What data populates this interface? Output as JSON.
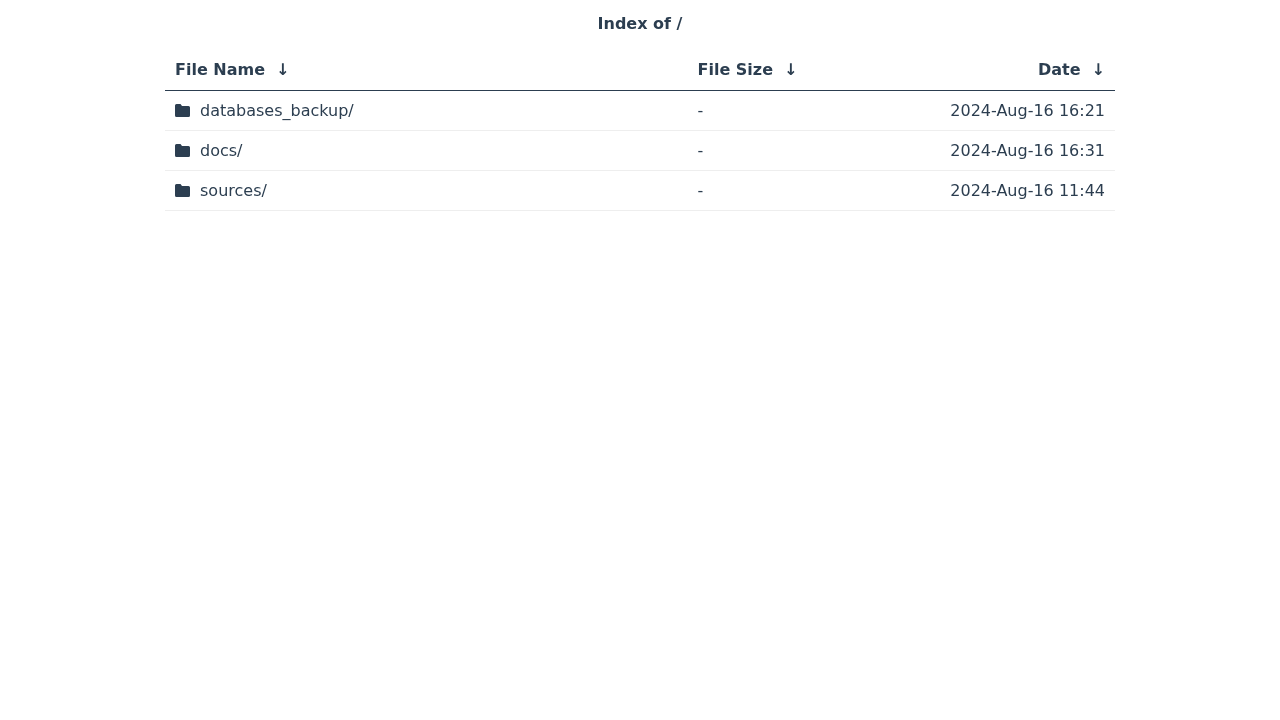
{
  "title": "Index of /",
  "columns": [
    {
      "label": "File Name",
      "sort_arrow": "↓"
    },
    {
      "label": "File Size",
      "sort_arrow": "↓"
    },
    {
      "label": "Date",
      "sort_arrow": "↓"
    }
  ],
  "rows": [
    {
      "kind": "folder",
      "name": "databases_backup/",
      "size": "-",
      "date": "2024-Aug-16 16:21"
    },
    {
      "kind": "folder",
      "name": "docs/",
      "size": "-",
      "date": "2024-Aug-16 16:31"
    },
    {
      "kind": "folder",
      "name": "sources/",
      "size": "-",
      "date": "2024-Aug-16 11:44"
    }
  ]
}
